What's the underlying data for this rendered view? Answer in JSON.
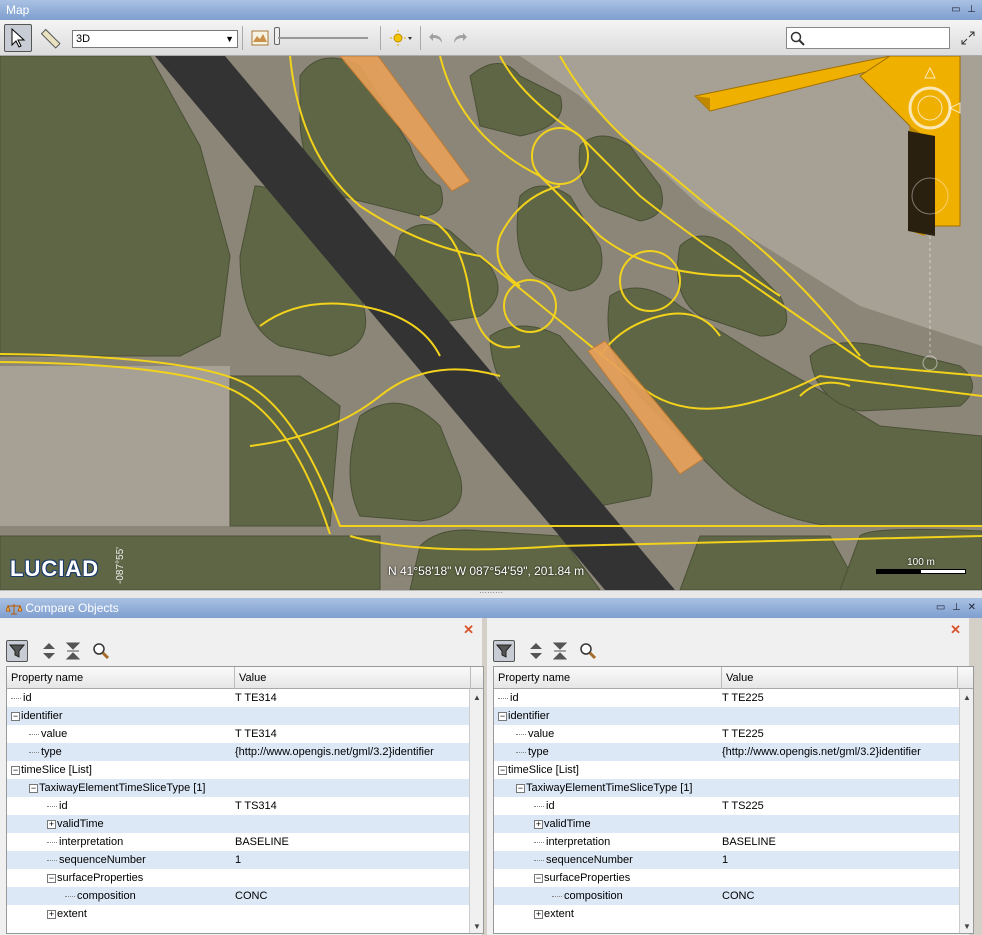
{
  "map_window": {
    "title": "Map"
  },
  "toolbar": {
    "view_mode": "3D",
    "search_placeholder": ""
  },
  "map": {
    "coordinates": "N 41°58'18\" W 087°54'59\", 201.84 m",
    "logo": "LUCIAD",
    "lon_label": "-087°55'",
    "scale_label": "100 m"
  },
  "compare_window": {
    "title": "Compare Objects"
  },
  "columns": {
    "property": "Property name",
    "value": "Value"
  },
  "left_rows": [
    {
      "indent": 0,
      "toggle": "",
      "name": "id",
      "value": "T TE314"
    },
    {
      "indent": 0,
      "toggle": "-",
      "name": "identifier",
      "value": ""
    },
    {
      "indent": 1,
      "toggle": "",
      "name": "value",
      "value": "T TE314"
    },
    {
      "indent": 1,
      "toggle": "",
      "name": "type",
      "value": "{http://www.opengis.net/gml/3.2}identifier"
    },
    {
      "indent": 0,
      "toggle": "-",
      "name": "timeSlice [List]",
      "value": ""
    },
    {
      "indent": 1,
      "toggle": "-",
      "name": "TaxiwayElementTimeSliceType [1]",
      "value": ""
    },
    {
      "indent": 2,
      "toggle": "",
      "name": "id",
      "value": "T TS314"
    },
    {
      "indent": 2,
      "toggle": "+",
      "name": "validTime",
      "value": ""
    },
    {
      "indent": 2,
      "toggle": "",
      "name": "interpretation",
      "value": "BASELINE"
    },
    {
      "indent": 2,
      "toggle": "",
      "name": "sequenceNumber",
      "value": "1"
    },
    {
      "indent": 2,
      "toggle": "-",
      "name": "surfaceProperties",
      "value": ""
    },
    {
      "indent": 3,
      "toggle": "",
      "name": "composition",
      "value": "CONC"
    },
    {
      "indent": 2,
      "toggle": "+",
      "name": "extent",
      "value": ""
    }
  ],
  "right_rows": [
    {
      "indent": 0,
      "toggle": "",
      "name": "id",
      "value": "T TE225"
    },
    {
      "indent": 0,
      "toggle": "-",
      "name": "identifier",
      "value": ""
    },
    {
      "indent": 1,
      "toggle": "",
      "name": "value",
      "value": "T TE225"
    },
    {
      "indent": 1,
      "toggle": "",
      "name": "type",
      "value": "{http://www.opengis.net/gml/3.2}identifier"
    },
    {
      "indent": 0,
      "toggle": "-",
      "name": "timeSlice [List]",
      "value": ""
    },
    {
      "indent": 1,
      "toggle": "-",
      "name": "TaxiwayElementTimeSliceType [1]",
      "value": ""
    },
    {
      "indent": 2,
      "toggle": "",
      "name": "id",
      "value": "T TS225"
    },
    {
      "indent": 2,
      "toggle": "+",
      "name": "validTime",
      "value": ""
    },
    {
      "indent": 2,
      "toggle": "",
      "name": "interpretation",
      "value": "BASELINE"
    },
    {
      "indent": 2,
      "toggle": "",
      "name": "sequenceNumber",
      "value": "1"
    },
    {
      "indent": 2,
      "toggle": "-",
      "name": "surfaceProperties",
      "value": ""
    },
    {
      "indent": 3,
      "toggle": "",
      "name": "composition",
      "value": "CONC"
    },
    {
      "indent": 2,
      "toggle": "+",
      "name": "extent",
      "value": ""
    }
  ],
  "colors": {
    "grass": "#5f6645",
    "pavement": "#8c8678",
    "runway": "#333333",
    "taxi_line": "#f2d21b",
    "highlight": "#e8a15a",
    "building": "#f0b000"
  }
}
